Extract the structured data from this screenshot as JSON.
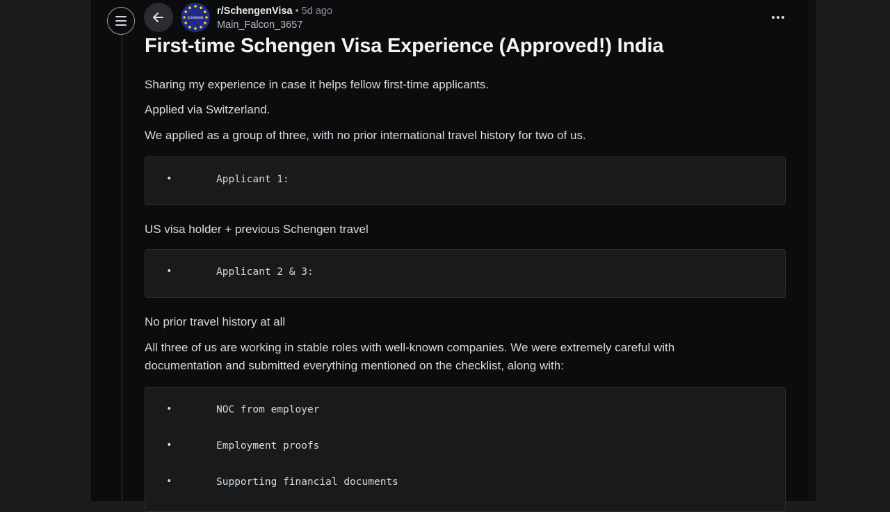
{
  "header": {
    "subreddit": "r/SchengenVisa",
    "separator": "•",
    "age": "5d ago",
    "author": "Main_Falcon_3657",
    "avatar_text": "SCHENGEN"
  },
  "post": {
    "title": "First-time Schengen Visa Experience (Approved!) India",
    "intro": "Sharing my experience in case it helps fellow first-time applicants.",
    "applied_via": "Applied via Switzerland.",
    "group": "We applied as a group of three, with no prior international travel history for two of us.",
    "applicant1": {
      "bullet": "•",
      "label": "Applicant 1:"
    },
    "applicant1_detail": "US visa holder + previous Schengen travel",
    "applicant23": {
      "bullet": "•",
      "label": "Applicant 2 & 3:"
    },
    "applicant23_detail": "No prior travel history at all",
    "working_line1": "All three of us are working in stable roles with well-known companies. We were extremely careful with",
    "working_line2": "documentation and submitted everything mentioned on the checklist, along with:",
    "docs": [
      {
        "bullet": "•",
        "text": "NOC from employer"
      },
      {
        "bullet": "•",
        "text": "Employment proofs"
      },
      {
        "bullet": "•",
        "text": "Supporting financial documents"
      }
    ]
  },
  "icons": {
    "menu": "hamburger-menu-icon",
    "back": "arrow-left-icon",
    "more": "more-horizontal-icon"
  },
  "colors": {
    "background": "#1b1b1b",
    "panel": "#0b0c0e",
    "code_block": "#181a1c",
    "text": "#d7dadc",
    "eu_blue": "#1f2a8c",
    "eu_star": "#f5d800"
  }
}
